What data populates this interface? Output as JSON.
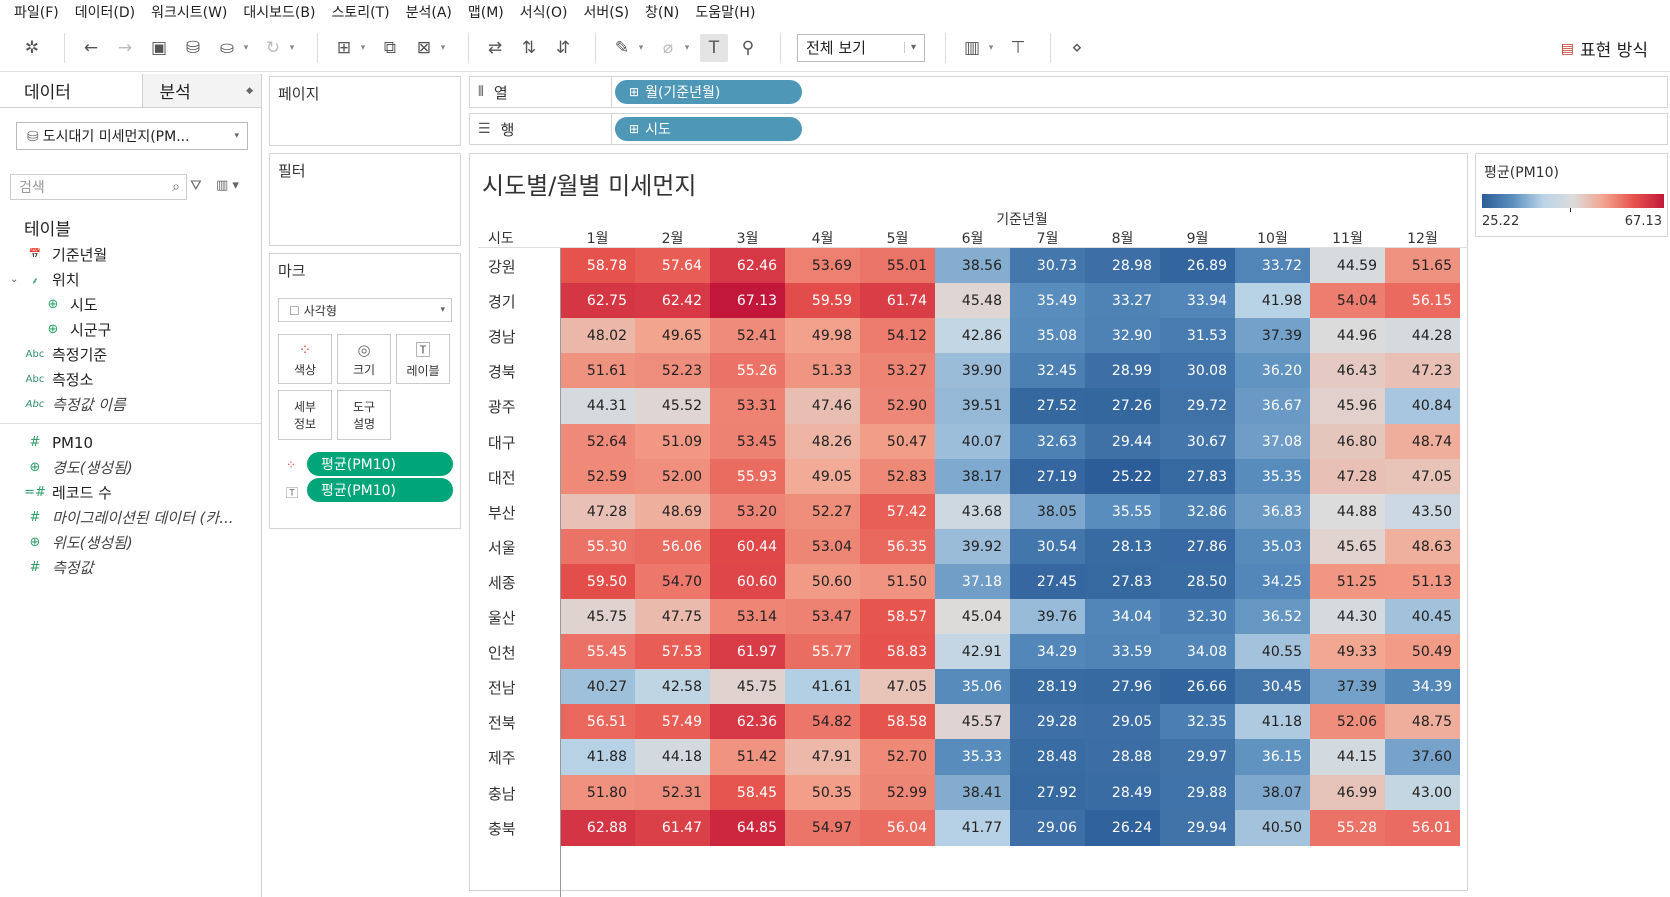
{
  "menu": [
    "파일(F)",
    "데이터(D)",
    "워크시트(W)",
    "대시보드(B)",
    "스토리(T)",
    "분석(A)",
    "맵(M)",
    "서식(O)",
    "서버(S)",
    "창(N)",
    "도움말(H)"
  ],
  "toolbar": {
    "fit_label": "전체 보기",
    "show_me_label": "표현 방식"
  },
  "data_pane": {
    "tab_data": "데이터",
    "tab_analysis": "분석",
    "datasource": "도시대기 미세먼지(PM...",
    "search_placeholder": "검색",
    "tables_heading": "테이블",
    "fields": [
      {
        "label": "기준년월",
        "type_icon": "📅"
      },
      {
        "label": "위치",
        "type_icon": "⸙"
      },
      {
        "label": "시도",
        "type_icon": "⊕"
      },
      {
        "label": "시군구",
        "type_icon": "⊕"
      },
      {
        "label": "측정기준",
        "type_icon": "Abc"
      },
      {
        "label": "측정소",
        "type_icon": "Abc"
      },
      {
        "label": "측정값 이름",
        "type_icon": "Abc"
      },
      {
        "label": "PM10",
        "type_icon": "#"
      },
      {
        "label": "경도(생성됨)",
        "type_icon": "⊕"
      },
      {
        "label": "레코드 수",
        "type_icon": "=#"
      },
      {
        "label": "마이그레이션된 데이터 (카...",
        "type_icon": "#"
      },
      {
        "label": "위도(생성됨)",
        "type_icon": "⊕"
      },
      {
        "label": "측정값",
        "type_icon": "#"
      }
    ]
  },
  "cards": {
    "pages": "페이지",
    "filters": "필터",
    "marks": "마크",
    "mark_type": "사각형",
    "mark_buttons": {
      "color": "색상",
      "size": "크기",
      "label": "레이블",
      "detail_1": "세부",
      "detail_2": "정보",
      "tooltip_1": "도구",
      "tooltip_2": "설명"
    },
    "mark_pills": [
      "평균(PM10)",
      "평균(PM10)"
    ]
  },
  "shelves": {
    "columns_label": "열",
    "rows_label": "행",
    "columns_pill": "월(기준년월)",
    "rows_pill": "시도"
  },
  "view": {
    "title": "시도별/월별 미세먼지",
    "col_header": "기준년월",
    "row_header": "시도"
  },
  "legend": {
    "title": "평균(PM10)",
    "min": "25.22",
    "max": "67.13",
    "colors": [
      "#2c5d98",
      "#5a8ebe",
      "#b9d3e6",
      "#dcdcdc",
      "#f3a58f",
      "#e6534d",
      "#c2173a"
    ]
  },
  "chart_data": {
    "type": "heatmap",
    "title": "시도별/월별 미세먼지",
    "xlabel": "기준년월",
    "ylabel": "시도",
    "color_measure": "평균(PM10)",
    "color_range": [
      25.22,
      67.13
    ],
    "months": [
      "1월",
      "2월",
      "3월",
      "4월",
      "5월",
      "6월",
      "7월",
      "8월",
      "9월",
      "10월",
      "11월",
      "12월"
    ],
    "regions": [
      "강원",
      "경기",
      "경남",
      "경북",
      "광주",
      "대구",
      "대전",
      "부산",
      "서울",
      "세종",
      "울산",
      "인천",
      "전남",
      "전북",
      "제주",
      "충남",
      "충북"
    ],
    "values": [
      [
        58.78,
        57.64,
        62.46,
        53.69,
        55.01,
        38.56,
        30.73,
        28.98,
        26.89,
        33.72,
        44.59,
        51.65
      ],
      [
        62.75,
        62.42,
        67.13,
        59.59,
        61.74,
        45.48,
        35.49,
        33.27,
        33.94,
        41.98,
        54.04,
        56.15
      ],
      [
        48.02,
        49.65,
        52.41,
        49.98,
        54.12,
        42.86,
        35.08,
        32.9,
        31.53,
        37.39,
        44.96,
        44.28
      ],
      [
        51.61,
        52.23,
        55.26,
        51.33,
        53.27,
        39.9,
        32.45,
        28.99,
        30.08,
        36.2,
        46.43,
        47.23
      ],
      [
        44.31,
        45.52,
        53.31,
        47.46,
        52.9,
        39.51,
        27.52,
        27.26,
        29.72,
        36.67,
        45.96,
        40.84
      ],
      [
        52.64,
        51.09,
        53.45,
        48.26,
        50.47,
        40.07,
        32.63,
        29.44,
        30.67,
        37.08,
        46.8,
        48.74
      ],
      [
        52.59,
        52.0,
        55.93,
        49.05,
        52.83,
        38.17,
        27.19,
        25.22,
        27.83,
        35.35,
        47.28,
        47.05
      ],
      [
        47.28,
        48.69,
        53.2,
        52.27,
        57.42,
        43.68,
        38.05,
        35.55,
        32.86,
        36.83,
        44.88,
        43.5
      ],
      [
        55.3,
        56.06,
        60.44,
        53.04,
        56.35,
        39.92,
        30.54,
        28.13,
        27.86,
        35.03,
        45.65,
        48.63
      ],
      [
        59.5,
        54.7,
        60.6,
        50.6,
        51.5,
        37.18,
        27.45,
        27.83,
        28.5,
        34.25,
        51.25,
        51.13
      ],
      [
        45.75,
        47.75,
        53.14,
        53.47,
        58.57,
        45.04,
        39.76,
        34.04,
        32.3,
        36.52,
        44.3,
        40.45
      ],
      [
        55.45,
        57.53,
        61.97,
        55.77,
        58.83,
        42.91,
        34.29,
        33.59,
        34.08,
        40.55,
        49.33,
        50.49
      ],
      [
        40.27,
        42.58,
        45.75,
        41.61,
        47.05,
        35.06,
        28.19,
        27.96,
        26.66,
        30.45,
        37.39,
        34.39
      ],
      [
        56.51,
        57.49,
        62.36,
        54.82,
        58.58,
        45.57,
        29.28,
        29.05,
        32.35,
        41.18,
        52.06,
        48.75
      ],
      [
        41.88,
        44.18,
        51.42,
        47.91,
        52.7,
        35.33,
        28.48,
        28.88,
        29.97,
        36.15,
        44.15,
        37.6
      ],
      [
        51.8,
        52.31,
        58.45,
        50.35,
        52.99,
        38.41,
        27.92,
        28.49,
        29.88,
        38.07,
        46.99,
        43.0
      ],
      [
        62.88,
        61.47,
        64.85,
        54.97,
        56.04,
        41.77,
        29.06,
        26.24,
        29.94,
        40.5,
        55.28,
        56.01
      ]
    ]
  }
}
